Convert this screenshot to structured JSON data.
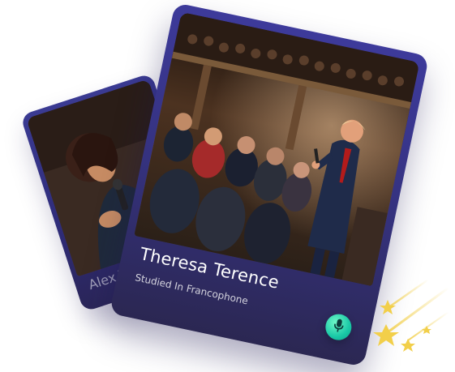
{
  "back_card": {
    "name": "Alex T"
  },
  "front_card": {
    "name": "Theresa Terence",
    "subtitle": "Studied In Francophone",
    "action_icon": "microphone-icon",
    "action_color": "#19c8a6"
  },
  "decorations": {
    "stars_left_icon": "shooting-stars-icon",
    "stars_right_icon": "shooting-stars-icon",
    "star_color": "#f2cf4a"
  }
}
